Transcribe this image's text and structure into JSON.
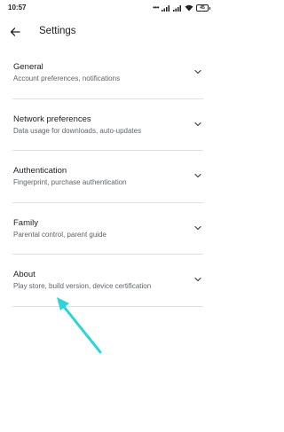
{
  "status_bar": {
    "time": "10:57",
    "battery": "45",
    "icons": [
      "dots-icon",
      "signal-icon",
      "signal-icon",
      "wifi-icon",
      "battery-icon"
    ]
  },
  "app_bar": {
    "back_icon": "arrow-left-icon",
    "title": "Settings"
  },
  "settings": [
    {
      "title": "General",
      "subtitle": "Account preferences, notifications"
    },
    {
      "title": "Network preferences",
      "subtitle": "Data usage for downloads, auto-updates"
    },
    {
      "title": "Authentication",
      "subtitle": "Fingerprint, purchase authentication"
    },
    {
      "title": "Family",
      "subtitle": "Parental control, parent guide"
    },
    {
      "title": "About",
      "subtitle": "Play store, build version, device certification"
    }
  ],
  "colors": {
    "background": "#ffffff",
    "text_primary": "#202124",
    "text_secondary": "#5f6368",
    "divider": "#e0e0e0",
    "annotation_arrow": "#2ad4d9"
  }
}
